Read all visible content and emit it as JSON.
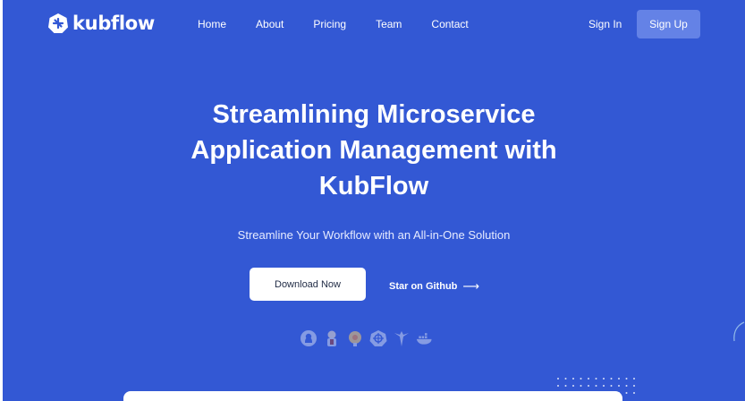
{
  "brand": {
    "name": "kubflow",
    "logo_icon": "kubflow-logo-icon"
  },
  "nav": {
    "links": [
      "Home",
      "About",
      "Pricing",
      "Team",
      "Contact"
    ],
    "signin_label": "Sign In",
    "signup_label": "Sign Up"
  },
  "hero": {
    "title_line1": "Streamlining Microservice",
    "title_line2": "Application Management with",
    "title_line3": "KubFlow",
    "subtitle": "Streamline Your Workflow with an All-in-One Solution",
    "download_label": "Download Now",
    "github_label": "Star on Github",
    "github_arrow": "⟶",
    "tech_icons": [
      "github-icon",
      "jenkins-icon",
      "grafana-icon",
      "kubernetes-icon",
      "argo-icon",
      "docker-icon"
    ]
  },
  "colors": {
    "background": "#3358d4",
    "signup_button": "#6482e6",
    "text": "#ffffff"
  }
}
